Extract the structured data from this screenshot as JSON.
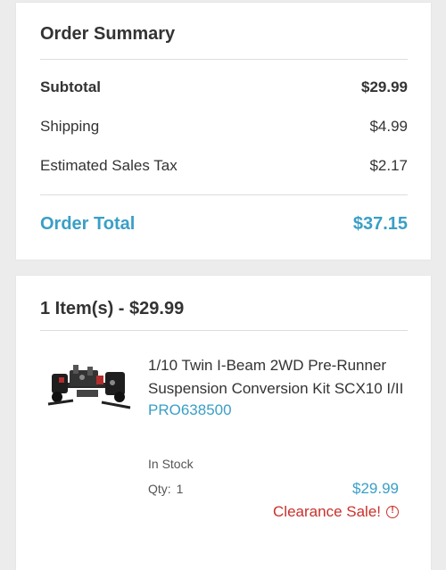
{
  "order_summary": {
    "title": "Order Summary",
    "subtotal_label": "Subtotal",
    "subtotal_value": "$29.99",
    "shipping_label": "Shipping",
    "shipping_value": "$4.99",
    "tax_label": "Estimated Sales Tax",
    "tax_value": "$2.17",
    "total_label": "Order Total",
    "total_value": "$37.15",
    "accent_color": "#3a9fc6"
  },
  "items": {
    "title": "1 Item(s) - $29.99",
    "list": [
      {
        "name": "1/10 Twin I-Beam 2WD Pre-Runner Suspension Conversion Kit SCX10 I/II",
        "sku": "PRO638500",
        "stock": "In Stock",
        "qty_label": "Qty:",
        "qty_value": "1",
        "price": "$29.99",
        "sale_label": "Clearance Sale!",
        "sale_icon": "alert-circle-icon",
        "sale_color": "#c9302c"
      }
    ]
  }
}
